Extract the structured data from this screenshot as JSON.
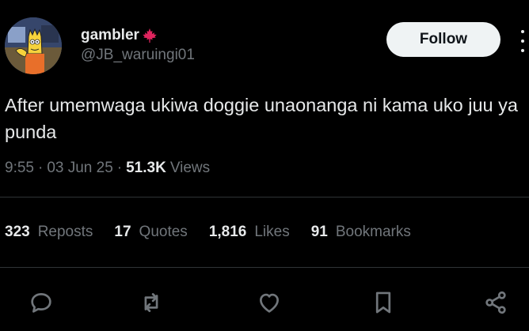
{
  "author": {
    "display_name": "gambler",
    "name_badge_icon": "maple-leaf-icon",
    "handle": "@JB_waruingi01",
    "avatar_icon": "cartoon-avatar"
  },
  "follow_button": {
    "label": "Follow"
  },
  "more_menu_icon": "more-vertical-icon",
  "tweet": {
    "text": "After umemwaga ukiwa doggie unaonanga ni kama uko juu ya punda",
    "time": "9:55",
    "date": "03 Jun 25",
    "views_count": "51.3K",
    "views_label": "Views"
  },
  "stats": [
    {
      "count": "323",
      "label": "Reposts"
    },
    {
      "count": "17",
      "label": "Quotes"
    },
    {
      "count": "1,816",
      "label": "Likes"
    },
    {
      "count": "91",
      "label": "Bookmarks"
    }
  ],
  "actions": [
    "reply-icon",
    "repost-icon",
    "like-icon",
    "bookmark-icon",
    "share-icon"
  ],
  "colors": {
    "background": "#000000",
    "text": "#e7e9ea",
    "secondary": "#71767b",
    "badge": "#e0245e"
  }
}
